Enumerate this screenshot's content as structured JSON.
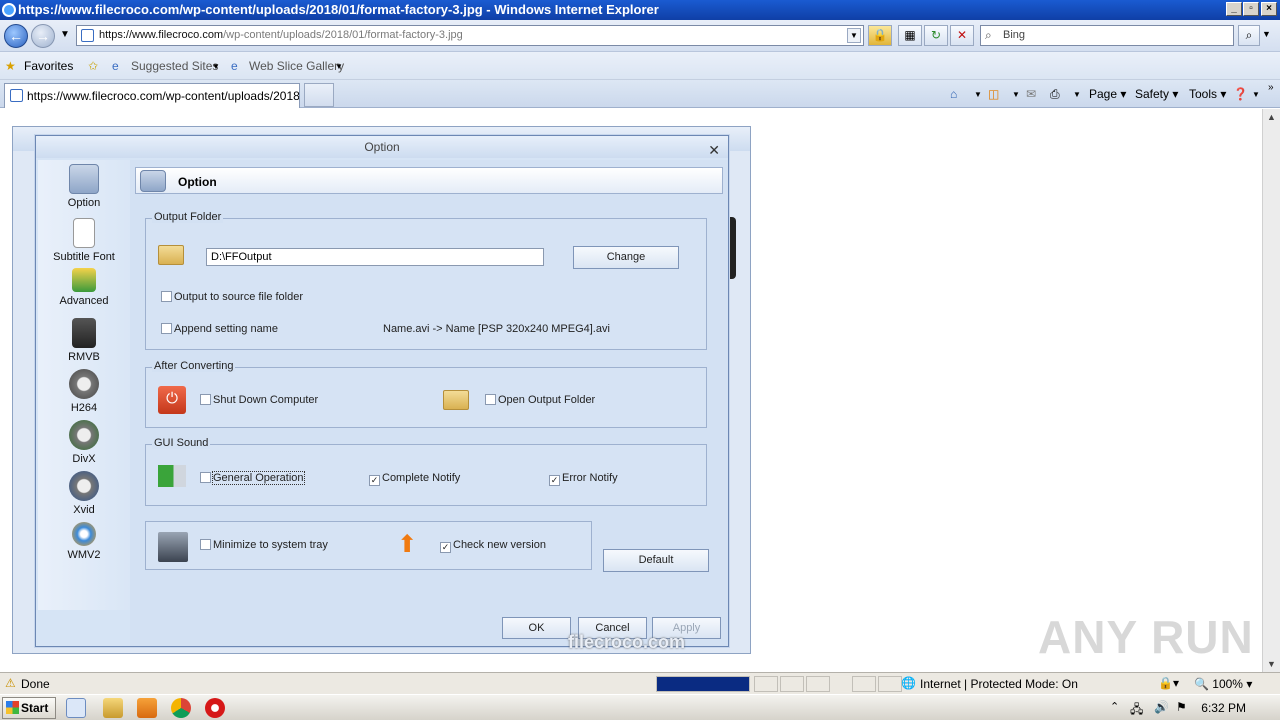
{
  "browser": {
    "title": "https://www.filecroco.com/wp-content/uploads/2018/01/format-factory-3.jpg - Windows Internet Explorer",
    "address_host": "https://www.filecroco.com",
    "address_path": "/wp-content/uploads/2018/01/format-factory-3.jpg",
    "search_placeholder": "Bing",
    "favorites_label": "Favorites",
    "suggested_sites": "Suggested Sites",
    "web_slice_gallery": "Web Slice Gallery",
    "tab_label": "https://www.filecroco.com/wp-content/uploads/2018...",
    "cmd_page": "Page",
    "cmd_safety": "Safety",
    "cmd_tools": "Tools"
  },
  "dialog": {
    "title": "Option",
    "header": "Option",
    "sidebar": [
      "Option",
      "Subtitle Font",
      "Advanced",
      "RMVB",
      "H264",
      "DivX",
      "Xvid",
      "WMV2"
    ],
    "output_folder": {
      "legend": "Output Folder",
      "path": "D:\\FFOutput",
      "change_label": "Change",
      "output_to_source": "Output to source file folder",
      "append_setting": "Append setting name",
      "example": "Name.avi  -> Name [PSP 320x240 MPEG4].avi"
    },
    "after_converting": {
      "legend": "After Converting",
      "shutdown": "Shut Down Computer",
      "open_output": "Open Output Folder"
    },
    "gui_sound": {
      "legend": "GUI Sound",
      "general": "General Operation",
      "complete": "Complete Notify",
      "error": "Error Notify"
    },
    "misc": {
      "minimize": "Minimize to system tray",
      "check_version": "Check new version"
    },
    "default_label": "Default",
    "ok_label": "OK",
    "cancel_label": "Cancel",
    "apply_label": "Apply",
    "checked_mark": "✓"
  },
  "statusbar": {
    "done": "Done",
    "zone": "Internet | Protected Mode: On",
    "zoom": "100%"
  },
  "taskbar": {
    "start": "Start",
    "clock": "6:32 PM"
  },
  "watermark": "ANY RUN",
  "filecroco_watermark": "filecroco.com"
}
